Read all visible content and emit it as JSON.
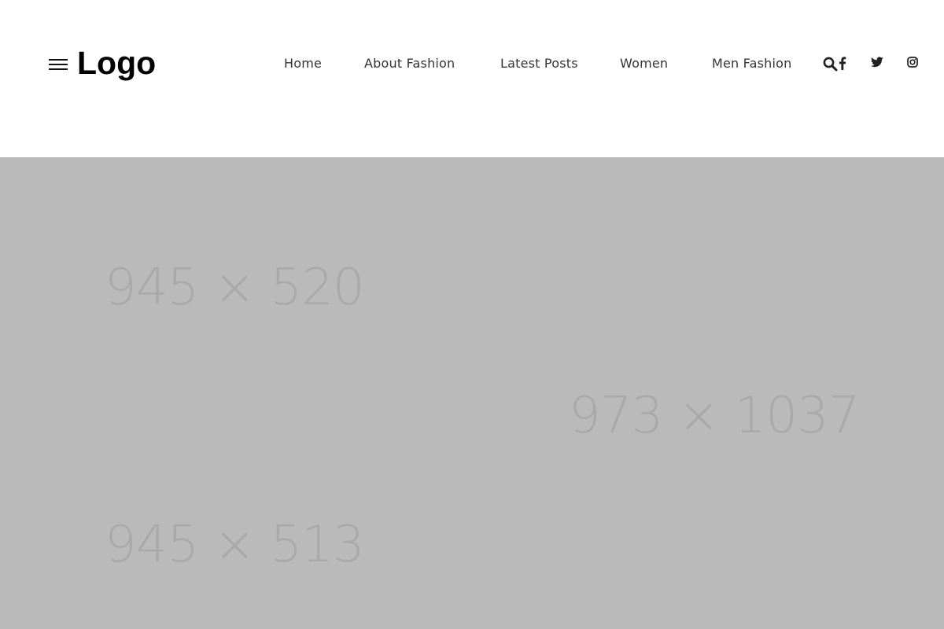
{
  "header": {
    "logo": "Logo",
    "nav": [
      {
        "label": "Home"
      },
      {
        "label": "About Fashion"
      },
      {
        "label": "Latest Posts"
      },
      {
        "label": "Women"
      },
      {
        "label": "Men Fashion"
      }
    ],
    "icons": [
      "menu-icon",
      "search-icon",
      "facebook-icon",
      "twitter-icon",
      "instagram-icon"
    ]
  },
  "hero": {
    "placeholders": [
      {
        "label": "945 × 520"
      },
      {
        "label": "973 × 1037"
      },
      {
        "label": "945 × 513"
      }
    ]
  },
  "colors": {
    "hero_background": "#bababa",
    "placeholder_text": "#a9a9a9",
    "nav_text": "#333333"
  }
}
